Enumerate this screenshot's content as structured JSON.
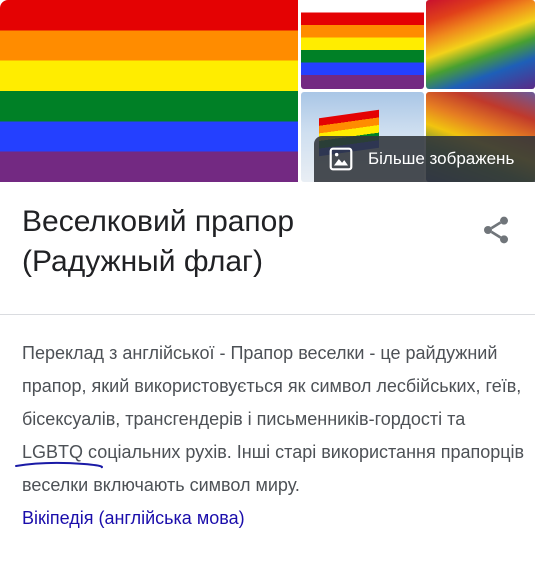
{
  "images": {
    "main_alt": "rainbow-flag",
    "tiles": [
      "rainbow-flag-stripes",
      "waving-rainbow-flag",
      "rainbow-flag-sky",
      "rainbow-flag-closeup"
    ],
    "more_images_label": "Більше зображень",
    "more_icon": "image-icon"
  },
  "header": {
    "title": "Веселковий прапор (Радужный флаг)",
    "share_icon": "share-icon"
  },
  "description": {
    "text_before": "Переклад з англійської - Прапор веселки - це райдужний прапор, який використовується як символ лесбійських, геїв, бісексуалів, трансгендерів і письменників-гордості та ",
    "highlighted": "LGBTQ",
    "text_after": " соціальних рухів. Інші старі використання прапорців веселки включають символ миру.",
    "source_link": "Вікіпедія (англійська мова)"
  },
  "colors": {
    "title": "#202124",
    "body_text": "#4d5156",
    "link": "#1a0dab",
    "divider": "#dadce0",
    "ink_underline": "#1a1aa6",
    "overlay": "#30343a"
  }
}
